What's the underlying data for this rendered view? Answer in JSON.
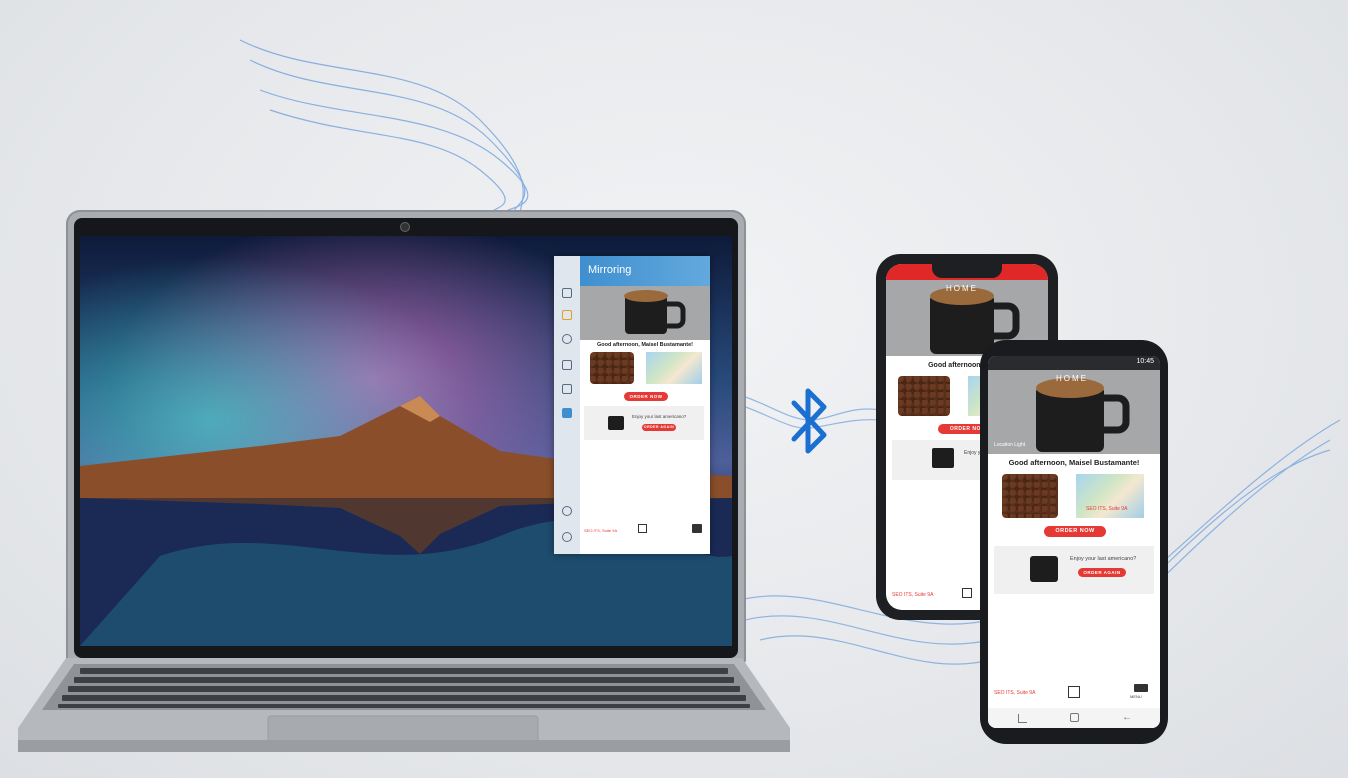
{
  "laptop": {
    "mirror_window": {
      "title": "Mirroring",
      "greeting": "Good afternoon, Maisel Bustamante!",
      "order_button": "ORDER NOW",
      "promo_text": "Enjoy your last americano?",
      "promo_button": "ORDER AGAIN",
      "store_label": "SEO ITS, Suite 9A"
    }
  },
  "connection_icon": "bluetooth-icon",
  "phone_back": {
    "app_title": "HOME",
    "greeting": "Good afternoon, Maisel",
    "order_button": "ORDER NOW",
    "promo_text": "Enjoy your last americano?",
    "store_label": "SEO ITS, Suite 9A"
  },
  "phone_front": {
    "status_time": "10:45",
    "app_title": "HOME",
    "carousel_caption": "Location Light",
    "greeting": "Good afternoon, Maisel Bustamante!",
    "map_label": "SEO ITS, Suite 9A",
    "order_button": "ORDER NOW",
    "promo_text": "Enjoy your last americano?",
    "promo_button": "ORDER AGAIN",
    "store_label": "SEO ITS, Suite 9A",
    "menu_label": "MENU"
  },
  "colors": {
    "accent_red": "#e53935",
    "bluetooth_blue": "#1a6fd1",
    "mirror_header": "#4a97d4"
  }
}
